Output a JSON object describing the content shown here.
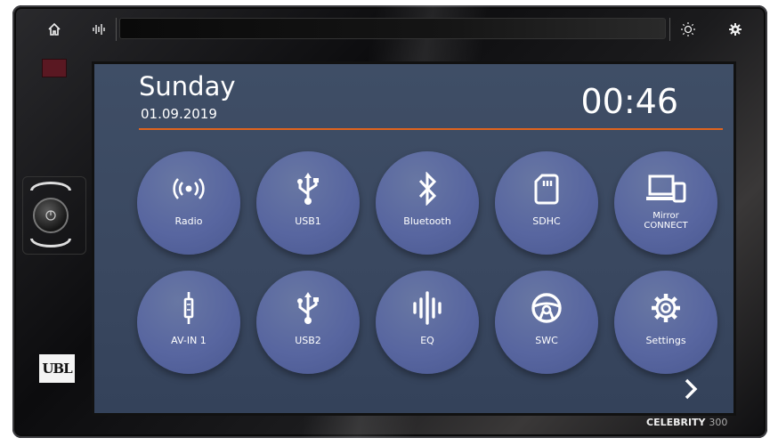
{
  "topbar": {
    "home_icon": "home-icon",
    "eq_icon": "equalizer-icon",
    "brightness_icon": "sun-icon",
    "settings_icon": "gear-icon"
  },
  "header": {
    "day": "Sunday",
    "date": "01.09.2019",
    "time": "00:46"
  },
  "tiles": [
    {
      "label": "Radio",
      "icon": "radio-signal-icon"
    },
    {
      "label": "USB1",
      "icon": "usb-icon"
    },
    {
      "label": "Bluetooth",
      "icon": "bluetooth-icon"
    },
    {
      "label": "SDHC",
      "icon": "sd-card-icon"
    },
    {
      "label_line1": "Mirror",
      "label_line2": "CONNECT",
      "icon": "mirror-connect-icon"
    },
    {
      "label": "AV-IN 1",
      "icon": "aux-plug-icon"
    },
    {
      "label": "USB2",
      "icon": "usb-icon"
    },
    {
      "label": "EQ",
      "icon": "eq-bars-icon"
    },
    {
      "label": "SWC",
      "icon": "steering-wheel-icon"
    },
    {
      "label": "Settings",
      "icon": "settings-gear-icon"
    }
  ],
  "device": {
    "logo": "UBL",
    "model": "CELEBRITY",
    "model_number": "300"
  },
  "colors": {
    "accent": "#e0641e",
    "tile": "#5866a0",
    "screen_bg": "#3a4860"
  }
}
